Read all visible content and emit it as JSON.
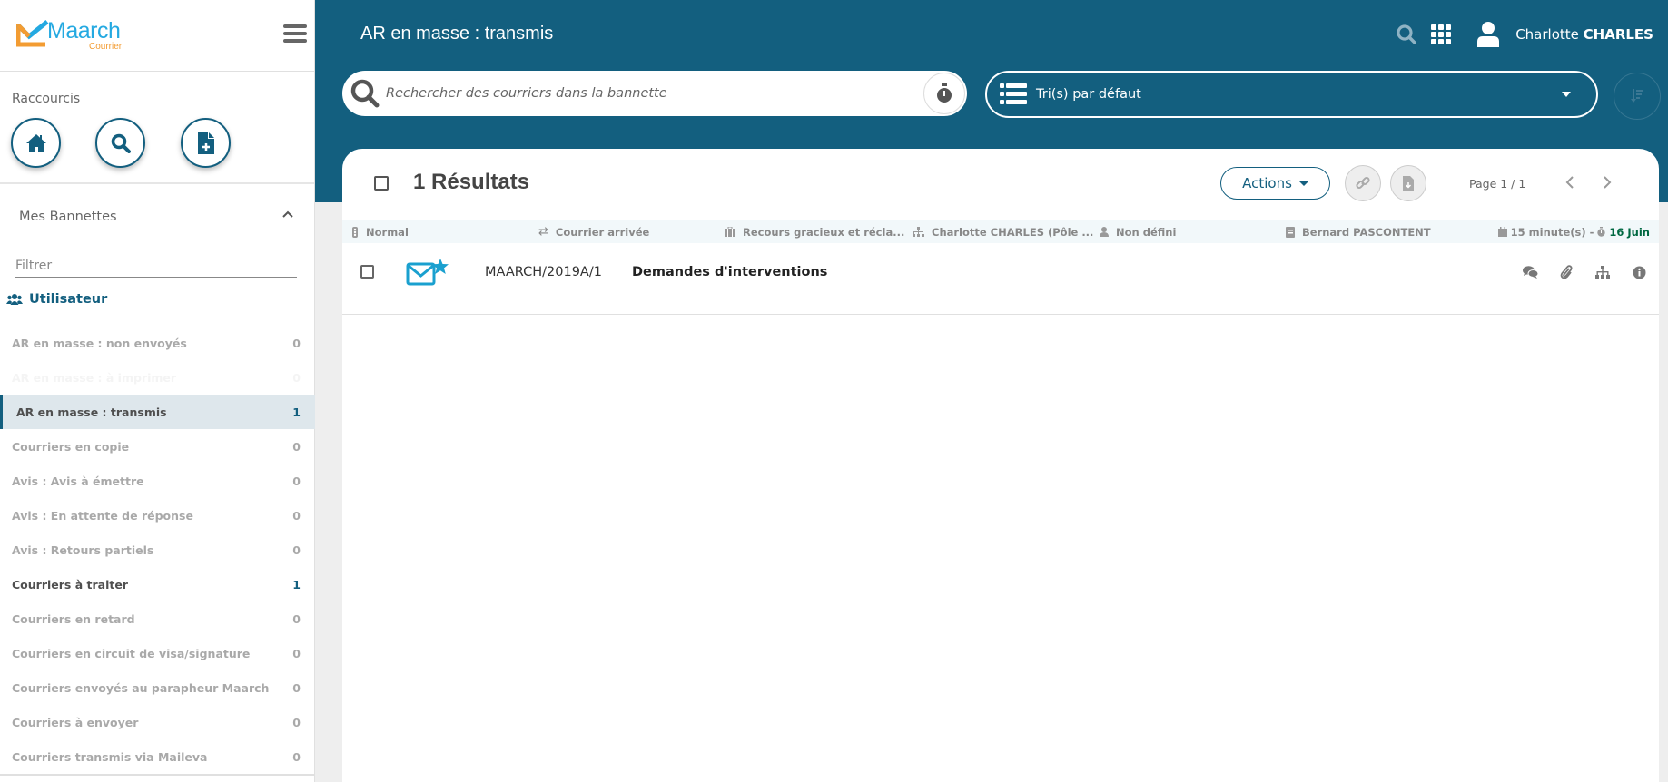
{
  "app": {
    "logo_main": "Maarch",
    "logo_sub": "Courrier"
  },
  "sidebar": {
    "shortcuts_label": "Raccourcis",
    "shortcuts": [
      {
        "name": "home",
        "icon": "home-icon"
      },
      {
        "name": "search",
        "icon": "search-icon"
      },
      {
        "name": "new-document",
        "icon": "file-plus-icon"
      }
    ],
    "bannettes_title": "Mes Bannettes",
    "filter_placeholder": "Filtrer",
    "group_label": "Utilisateur",
    "baskets": [
      {
        "label": "AR en masse : non envoyés",
        "count": "0",
        "state": "empty"
      },
      {
        "label": "AR en masse : à imprimer",
        "count": "0",
        "state": "ghost"
      },
      {
        "label": "AR en masse : transmis",
        "count": "1",
        "state": "active"
      },
      {
        "label": "Courriers en copie",
        "count": "0",
        "state": "empty"
      },
      {
        "label": "Avis : Avis à émettre",
        "count": "0",
        "state": "empty"
      },
      {
        "label": "Avis : En attente de réponse",
        "count": "0",
        "state": "empty"
      },
      {
        "label": "Avis : Retours partiels",
        "count": "0",
        "state": "empty"
      },
      {
        "label": "Courriers à traiter",
        "count": "1",
        "state": "has"
      },
      {
        "label": "Courriers en retard",
        "count": "0",
        "state": "empty"
      },
      {
        "label": "Courriers en circuit de visa/signature",
        "count": "0",
        "state": "empty"
      },
      {
        "label": "Courriers envoyés au parapheur Maarch",
        "count": "0",
        "state": "empty"
      },
      {
        "label": "Courriers à envoyer",
        "count": "0",
        "state": "empty"
      },
      {
        "label": "Courriers transmis via Maileva",
        "count": "0",
        "state": "empty"
      }
    ]
  },
  "header": {
    "title": "AR en masse : transmis",
    "user_first": "Charlotte",
    "user_last": "CHARLES",
    "search_placeholder": "Rechercher des courriers dans la bannette",
    "sort_label": "Tri(s) par défaut"
  },
  "results": {
    "title": "1 Résultats",
    "actions_label": "Actions",
    "page_info": "Page 1 / 1",
    "items": [
      {
        "priority": "Normal",
        "category": "Courrier arrivée",
        "doctype": "Recours gracieux et récla...",
        "entity": "Charlotte CHARLES (Pôle ...",
        "contact": "Non défini",
        "recipient": "Bernard PASCONTENT",
        "delay": "15 minute(s) -",
        "deadline": "16 Juin",
        "chrono": "MAARCH/2019A/1",
        "subject": "Demandes d'interventions"
      }
    ]
  },
  "colors": {
    "primary": "#135f7f",
    "logo_blue": "#24a9e1",
    "logo_orange": "#f39c32",
    "deadline_green": "#006841",
    "mail_icon": "#1aa0cf"
  }
}
